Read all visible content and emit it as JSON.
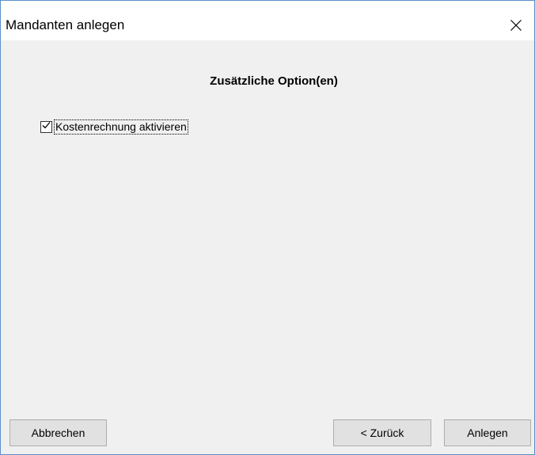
{
  "window": {
    "title": "Mandanten anlegen"
  },
  "main": {
    "heading": "Zusätzliche Option(en)",
    "checkbox": {
      "label": "Kostenrechnung aktivieren",
      "checked": true
    }
  },
  "buttons": {
    "cancel": "Abbrechen",
    "back": "< Zurück",
    "create": "Anlegen"
  },
  "icons": {
    "close": "close-icon",
    "check": "checkmark-icon"
  }
}
